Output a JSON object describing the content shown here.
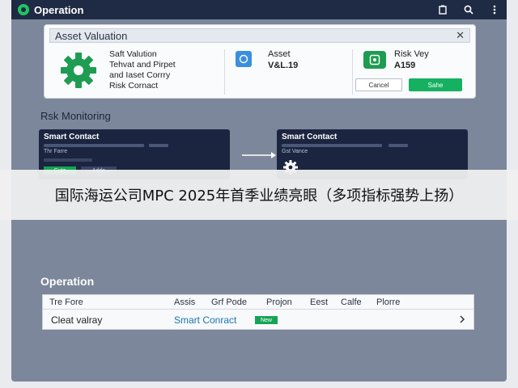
{
  "header": {
    "title": "Operation",
    "icons": [
      "copy-icon",
      "search-icon",
      "more-vertical-icon"
    ]
  },
  "asset_card": {
    "title": "Asset Valuation",
    "close": "✕",
    "description": "Saft Valution\nTehvat and Pirpet\nand Iaset Corrry\nRisk Cornact",
    "asset_label": "Asset",
    "asset_value": "V&L.19",
    "risk_label": "Risk Vey",
    "risk_value": "A159",
    "cancel_label": "Cancel",
    "ok_label": "Sahe"
  },
  "risk_monitoring": {
    "title": "Rsk Monitoring",
    "left_card": {
      "title": "Smart Contact",
      "sub": "Thr Farre",
      "btn1": "Cuto",
      "btn2": "Adde"
    },
    "right_card": {
      "title": "Smart Contact",
      "sub": "Gst Vance"
    }
  },
  "overlay": {
    "text": "国际海运公司MPC 2025年首季业绩亮眼（多项指标强势上扬）"
  },
  "operation": {
    "title": "Operation",
    "columns": [
      "Tre Fore",
      "Assis",
      "Grf Pode",
      "Projon",
      "Eest",
      "Calfe",
      "Plorre"
    ],
    "row": {
      "name": "Cleat valray",
      "link": "Smart Conract",
      "badge": "New"
    }
  },
  "colors": {
    "topbar": "#1f2b45",
    "frame": "#7d879b",
    "accent_green": "#16b160",
    "accent_blue": "#3b8fde"
  }
}
